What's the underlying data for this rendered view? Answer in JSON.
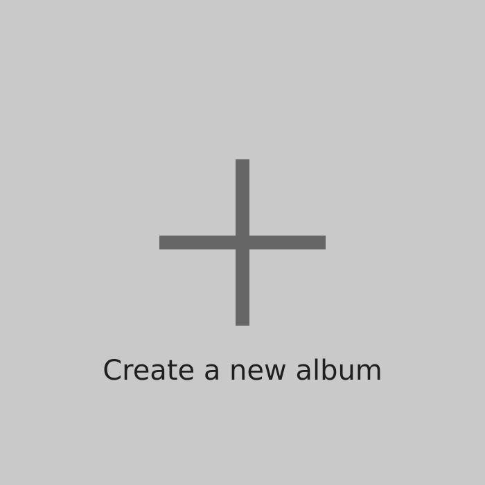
{
  "create_album": {
    "label": "Create a new album",
    "icon": "plus-icon",
    "colors": {
      "background": "#c9c9c9",
      "icon": "#666666",
      "text": "#1f1f1f"
    }
  }
}
